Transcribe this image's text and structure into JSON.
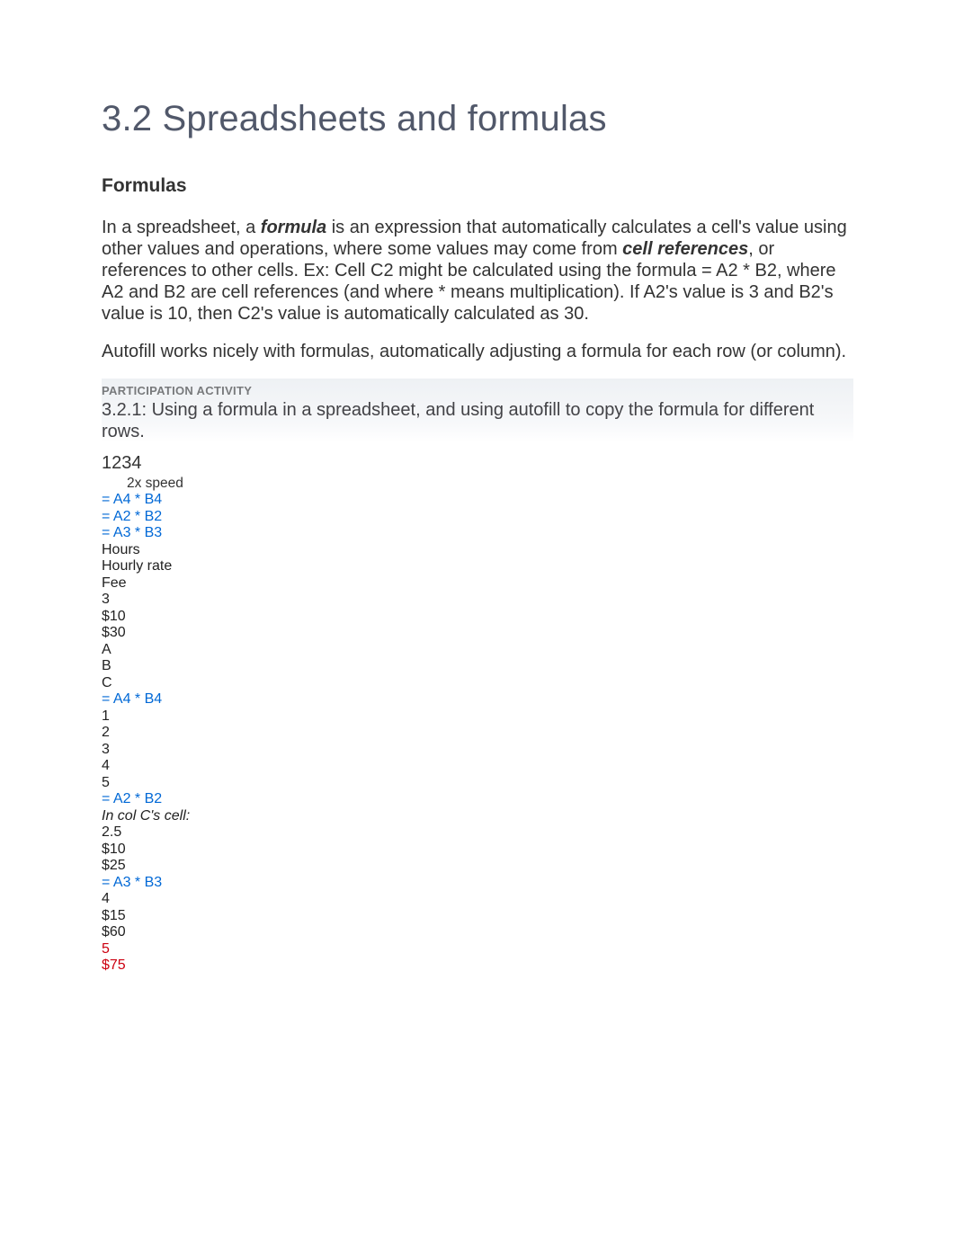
{
  "title": "3.2 Spreadsheets and formulas",
  "section_heading": "Formulas",
  "para1_pre": "In a spreadsheet, a ",
  "para1_term1": "formula",
  "para1_mid1": " is an expression that automatically calculates a cell's value using other values and operations, where some values may come from ",
  "para1_term2": "cell references",
  "para1_post": ", or references to other cells. Ex: Cell C2 might be calculated using the formula = A2 * B2, where A2 and B2 are cell references (and where * means multiplication). If A2's value is 3 and B2's value is 10, then C2's value is automatically calculated as 30.",
  "para2": "Autofill works nicely with formulas, automatically adjusting a formula for each row (or column).",
  "activity_label": "PARTICIPATION ACTIVITY",
  "activity_title": "3.2.1: Using a formula in a spreadsheet, and using autofill to copy the formula for different rows.",
  "counter": "1234",
  "speed": "2x speed",
  "lines": [
    {
      "text": "= A4 * B4",
      "cls": "blue"
    },
    {
      "text": "= A2 * B2",
      "cls": "blue"
    },
    {
      "text": "= A3 * B3",
      "cls": "blue"
    },
    {
      "text": "Hours",
      "cls": ""
    },
    {
      "text": "Hourly rate",
      "cls": ""
    },
    {
      "text": "Fee",
      "cls": ""
    },
    {
      "text": "3",
      "cls": ""
    },
    {
      "text": "$10",
      "cls": ""
    },
    {
      "text": "$30",
      "cls": ""
    },
    {
      "text": "A",
      "cls": ""
    },
    {
      "text": "B",
      "cls": ""
    },
    {
      "text": "C",
      "cls": ""
    },
    {
      "text": "= A4 * B4",
      "cls": "blue"
    },
    {
      "text": "1",
      "cls": ""
    },
    {
      "text": "2",
      "cls": ""
    },
    {
      "text": "3",
      "cls": ""
    },
    {
      "text": "4",
      "cls": ""
    },
    {
      "text": "5",
      "cls": ""
    },
    {
      "text": "= A2 * B2",
      "cls": "blue"
    },
    {
      "text": "In col C's cell:",
      "cls": "italic"
    },
    {
      "text": "2.5",
      "cls": ""
    },
    {
      "text": "$10",
      "cls": ""
    },
    {
      "text": "$25",
      "cls": ""
    },
    {
      "text": "= A3 * B3",
      "cls": "blue"
    },
    {
      "text": "4",
      "cls": ""
    },
    {
      "text": "$15",
      "cls": ""
    },
    {
      "text": "$60",
      "cls": ""
    },
    {
      "text": "5",
      "cls": "red"
    },
    {
      "text": "$75",
      "cls": "red"
    }
  ]
}
